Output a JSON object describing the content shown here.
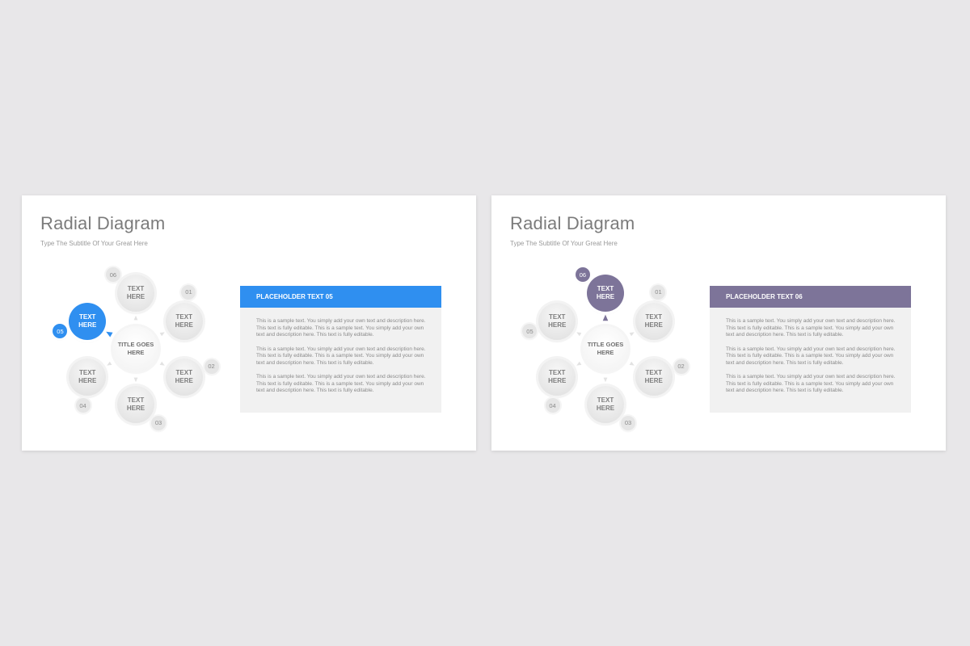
{
  "colors": {
    "blue": "#2f8ff0",
    "purple": "#7d7499",
    "node": "#e6e6e6"
  },
  "slides": [
    {
      "title": "Radial Diagram",
      "subtitle": "Type The Subtitle Of Your Great Here",
      "center_label": "TITLE GOES\nHERE",
      "active_index": 5,
      "accent": "#2f8ff0",
      "nodes": [
        {
          "num": "01",
          "label": "TEXT\nHERE"
        },
        {
          "num": "02",
          "label": "TEXT\nHERE"
        },
        {
          "num": "03",
          "label": "TEXT\nHERE"
        },
        {
          "num": "04",
          "label": "TEXT\nHERE"
        },
        {
          "num": "05",
          "label": "TEXT\nHERE"
        },
        {
          "num": "06",
          "label": "TEXT\nHERE"
        }
      ],
      "panel": {
        "header": "PLACEHOLDER TEXT 05",
        "paragraphs": [
          "This is a sample text. You simply add your own text and description here. This text is fully editable. This is a sample text. You simply add your own text and description here. This text is fully editable.",
          "This is a sample text. You simply add your own text and description here. This text is fully editable. This is a sample text. You simply add your own text and description here. This text is fully editable.",
          "This is a sample text. You simply add your own text and description here. This text is fully editable. This is a sample text. You simply add your own text and description here. This text is fully editable."
        ]
      }
    },
    {
      "title": "Radial Diagram",
      "subtitle": "Type The Subtitle Of Your Great Here",
      "center_label": "TITLE GOES\nHERE",
      "active_index": 6,
      "accent": "#7d7499",
      "nodes": [
        {
          "num": "01",
          "label": "TEXT\nHERE"
        },
        {
          "num": "02",
          "label": "TEXT\nHERE"
        },
        {
          "num": "03",
          "label": "TEXT\nHERE"
        },
        {
          "num": "04",
          "label": "TEXT\nHERE"
        },
        {
          "num": "05",
          "label": "TEXT\nHERE"
        },
        {
          "num": "06",
          "label": "TEXT\nHERE"
        }
      ],
      "panel": {
        "header": "PLACEHOLDER TEXT 06",
        "paragraphs": [
          "This is a sample text. You simply add your own text and description here. This text is fully editable. This is a sample text. You simply add your own text and description here. This text is fully editable.",
          "This is a sample text. You simply add your own text and description here. This text is fully editable. This is a sample text. You simply add your own text and description here. This text is fully editable.",
          "This is a sample text. You simply add your own text and description here. This text is fully editable. This is a sample text. You simply add your own text and description here. This text is fully editable."
        ]
      }
    }
  ]
}
